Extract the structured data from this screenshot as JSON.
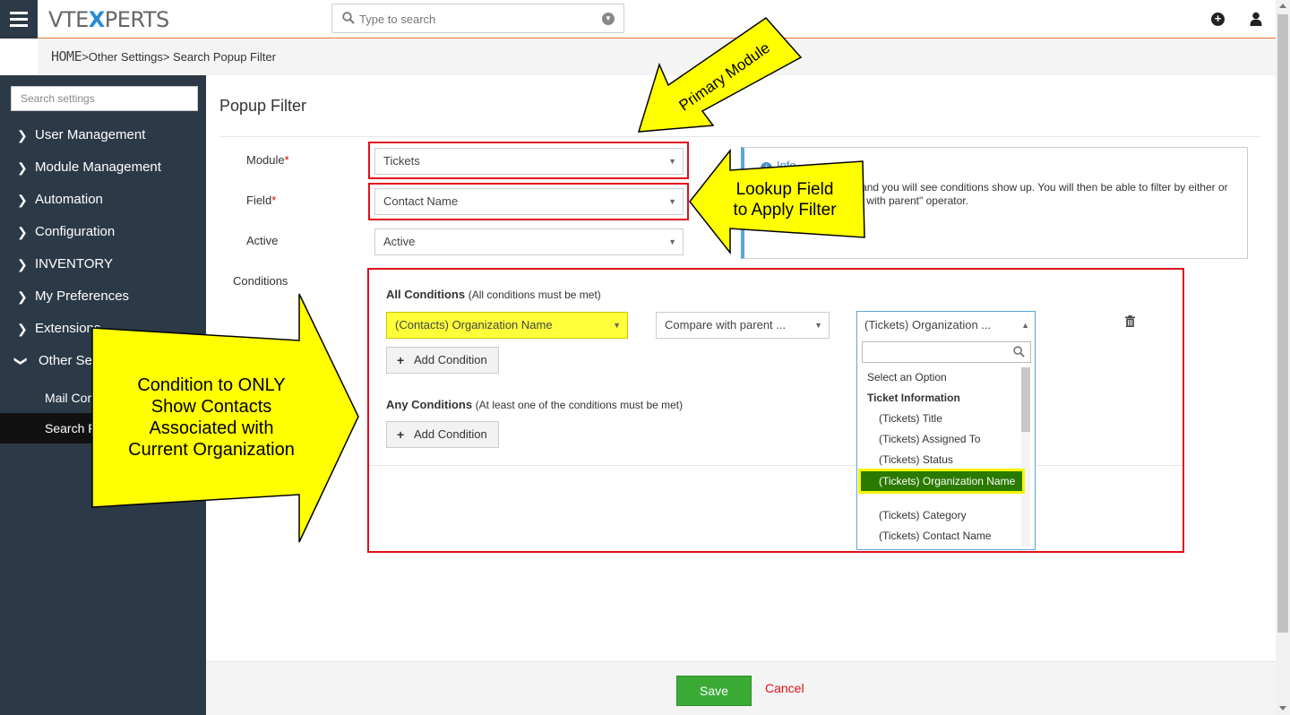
{
  "topbar": {
    "logo_pre": "VTE",
    "logo_x": "X",
    "logo_post": "PERTS",
    "search_placeholder": "Type to search"
  },
  "breadcrumb": {
    "home": "HOME",
    "item1": ">Other Settings",
    "sep": ">",
    "item2": " Search Popup Filter"
  },
  "sidebar": {
    "search_placeholder": "Search settings",
    "items": [
      {
        "label": "User Management"
      },
      {
        "label": "Module Management"
      },
      {
        "label": "Automation"
      },
      {
        "label": "Configuration"
      },
      {
        "label": "INVENTORY"
      },
      {
        "label": "My Preferences"
      },
      {
        "label": "Extensions"
      },
      {
        "label": "Other Settings"
      }
    ],
    "subitems": [
      {
        "label": "Mail Converter"
      },
      {
        "label": "Search Popup Filter"
      }
    ]
  },
  "form": {
    "title": "Popup Filter",
    "module_label": "Module",
    "field_label": "Field",
    "active_label": "Active",
    "conditions_label": "Conditions",
    "required_mark": "*",
    "module_value": "Tickets",
    "field_value": "Contact Name",
    "active_value": "Active"
  },
  "info": {
    "title": "Info",
    "text": "Select a related field and you will see conditions show up. You will then be able to filter by either or dynamic by \"compare with parent\" operator."
  },
  "conditions": {
    "all_title": "All Conditions",
    "all_hint": "(All conditions must be met)",
    "any_title": "Any Conditions",
    "any_hint": "(At least one of the conditions must be met)",
    "field_value": "(Contacts) Organization Name",
    "operator_value": "Compare with parent ...",
    "parent_value": "(Tickets) Organization ...",
    "add_label": "Add Condition"
  },
  "dropdown": {
    "options": [
      {
        "label": "Select an Option"
      },
      {
        "label": "Ticket Information"
      },
      {
        "label": "(Tickets) Title"
      },
      {
        "label": "(Tickets) Assigned To"
      },
      {
        "label": "(Tickets) Status"
      },
      {
        "label": "(Tickets) Organization Name"
      },
      {
        "label": "(Tickets) Category"
      },
      {
        "label": "(Tickets) Contact Name"
      }
    ]
  },
  "footer": {
    "save_label": "Save",
    "cancel_label": "Cancel"
  },
  "annotations": {
    "primary_module": "Primary Module",
    "lookup_line1": "Lookup Field",
    "lookup_line2": "to Apply Filter",
    "condition_line1": "Condition to ONLY",
    "condition_line2": "Show Contacts",
    "condition_line3": "Associated with",
    "condition_line4": "Current Organization"
  },
  "colors": {
    "accent": "#e8702a",
    "sidebar": "#2c3a47",
    "callout_fill": "#ffff00",
    "highlight_box": "#e0101a",
    "save_button": "#3aaa35",
    "selected_option": "#2a7a00"
  }
}
